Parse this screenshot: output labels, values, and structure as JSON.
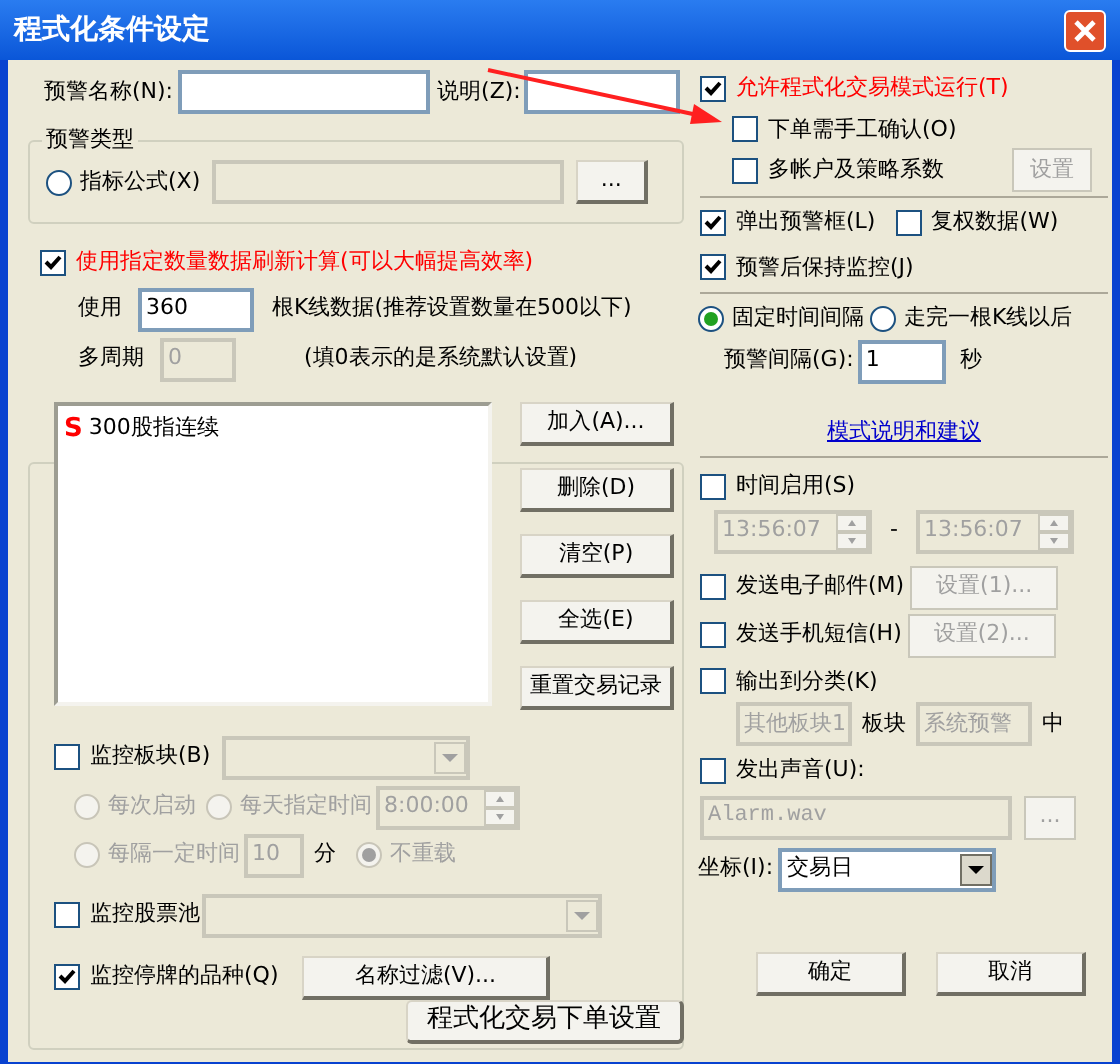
{
  "window": {
    "title": "程式化条件设定"
  },
  "name_row": {
    "name_label": "预警名称(N):",
    "desc_label": "说明(Z):"
  },
  "alert_type": {
    "title": "预警类型",
    "radio": {
      "label": "指标公式(X)",
      "selected": false
    },
    "browse": "..."
  },
  "refresh": {
    "label": "使用指定数量数据刷新计算(可以大幅提高效率)",
    "checked": true,
    "use_label": "使用",
    "count": "360",
    "count_note": "根K线数据(推荐设置数量在500以下)",
    "period_label": "多周期",
    "period_value": "0",
    "period_disabled": true,
    "period_note": "(填0表示的是系统默认设置)"
  },
  "list": {
    "items": [
      {
        "marker": "S",
        "name": "300股指连续",
        "color": "#ff0000"
      }
    ]
  },
  "list_buttons": [
    "加入(A)...",
    "删除(D)",
    "清空(P)",
    "全选(E)",
    "重置交易记录"
  ],
  "sector": {
    "label": "监控板块(B)",
    "checked": false,
    "reload": [
      {
        "label": "每次启动",
        "selected": false
      },
      {
        "label": "每天指定时间",
        "selected": false,
        "time": "8:00:00"
      },
      {
        "label": "每隔一定时间",
        "selected": false,
        "value": "10",
        "unit": "分"
      },
      {
        "label": "不重载",
        "selected": true
      }
    ]
  },
  "pool": {
    "label": "监控股票池",
    "checked": false
  },
  "suspended": {
    "label": "监控停牌的品种(Q)",
    "checked": true,
    "button": "名称过滤(V)..."
  },
  "order_button": "程式化交易下单设置",
  "trading": {
    "label": "允许程式化交易模式运行(T)",
    "checked": true,
    "options": [
      {
        "label": "下单需手工确认(O)",
        "checked": false
      },
      {
        "label": "多帐户及策略系数",
        "checked": false
      }
    ],
    "settings_button": "设置",
    "settings_disabled": true
  },
  "alerts": [
    {
      "label": "弹出预警框(L)",
      "checked": true
    },
    {
      "label": "复权数据(W)",
      "checked": false
    },
    {
      "label": "预警后保持监控(J)",
      "checked": true
    }
  ],
  "interval": {
    "modes": [
      {
        "label": "固定时间间隔",
        "selected": true
      },
      {
        "label": "走完一根K线以后",
        "selected": false
      }
    ],
    "label": "预警间隔(G):",
    "value": "1",
    "unit": "秒"
  },
  "help_link": "模式说明和建议",
  "time_enable": {
    "label": "时间启用(S)",
    "checked": false,
    "start": "13:56:07",
    "separator": "-",
    "end": "13:56:07"
  },
  "notify": [
    {
      "label": "发送电子邮件(M)",
      "checked": false,
      "button": "设置(1)..."
    },
    {
      "label": "发送手机短信(H)",
      "checked": false,
      "button": "设置(2)..."
    }
  ],
  "output": {
    "label": "输出到分类(K)",
    "checked": false,
    "sector": "其他板块1",
    "sector_label": "板块",
    "category": "系统预警",
    "suffix": "中"
  },
  "sound": {
    "label": "发出声音(U):",
    "checked": false,
    "file": "Alarm.wav",
    "browse": "..."
  },
  "axis": {
    "label": "坐标(I):",
    "value": "交易日"
  },
  "buttons": [
    "确定",
    "取消"
  ]
}
